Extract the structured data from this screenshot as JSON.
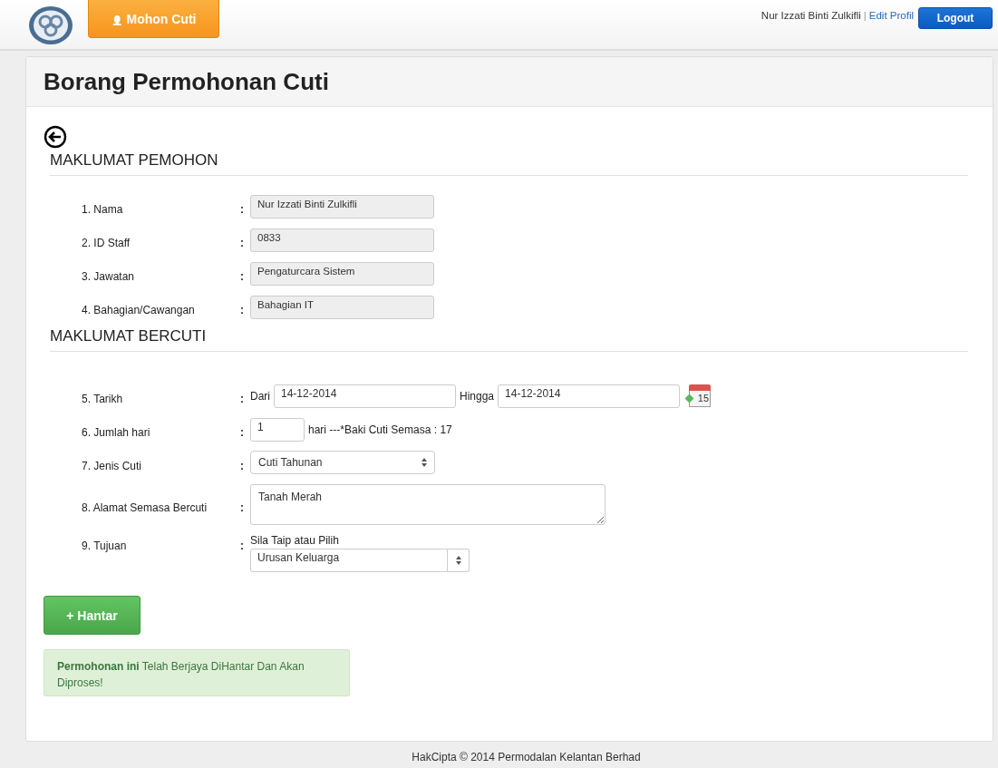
{
  "header": {
    "nav_button": {
      "icon": "👤",
      "label": "Mohon Cuti"
    },
    "user_name": "Nur Izzati Binti Zulkifli",
    "separator": "|",
    "edit_link": "Edit Profil",
    "logout_button": "Logout"
  },
  "page_title": "Borang Permohonan Cuti",
  "sections": [
    {
      "title": "MAKLUMAT PEMOHON",
      "rows": [
        {
          "kind": "readonly",
          "label": "1. Nama",
          "colon": ":",
          "value": "Nur Izzati Binti Zulkifli"
        },
        {
          "kind": "readonly",
          "label": "2. ID Staff",
          "colon": ":",
          "value": "0833"
        },
        {
          "kind": "readonly",
          "label": "3. Jawatan",
          "colon": ":",
          "value": "Pengaturcara Sistem"
        },
        {
          "kind": "readonly",
          "label": "4. Bahagian/Cawangan",
          "colon": ":",
          "value": "Bahagian IT"
        }
      ]
    },
    {
      "title": "MAKLUMAT BERCUTI",
      "rows": [
        {
          "kind": "daterange",
          "label": "5. Tarikh",
          "colon": ":",
          "from_label": "Dari",
          "from": "14-12-2014",
          "to_label": "Hingga",
          "to": "14-12-2014",
          "calendar_day": "15"
        },
        {
          "kind": "days",
          "label": "6. Jumlah hari",
          "colon": ":",
          "value": "1",
          "note": "hari ---*Baki Cuti Semasa : 17"
        },
        {
          "kind": "select",
          "label": "7. Jenis Cuti",
          "colon": ":",
          "value": "Cuti Tahunan"
        },
        {
          "kind": "textarea",
          "label": "8. Alamat Semasa Bercuti",
          "colon": ":",
          "value": "Tanah Merah"
        },
        {
          "kind": "combo",
          "label": "9. Tujuan",
          "colon": ":",
          "hint": "Sila Taip atau Pilih",
          "value": "Urusan Keluarga"
        }
      ]
    }
  ],
  "submit_button": "+ Hantar",
  "alert": "**Permohonan ini** Telah Berjaya DiHantar Dan Akan Diproses!",
  "footer": "HakCipta © 2014 Permodalan Kelantan Berhad"
}
